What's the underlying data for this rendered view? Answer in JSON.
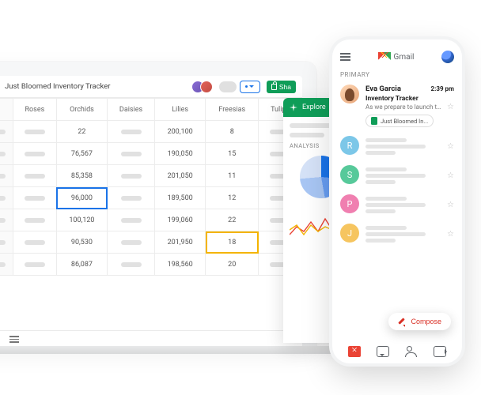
{
  "sheets": {
    "title": "Just Bloomed Inventory Tracker",
    "share_label": "Sha",
    "columns": [
      "Roses",
      "Orchids",
      "Daisies",
      "Lilies",
      "Freesias",
      "Tulips"
    ],
    "rows": [
      {
        "orchids": "22",
        "daisies": null,
        "lilies": "200,100",
        "freesias": "8"
      },
      {
        "orchids": "76,567",
        "daisies": null,
        "lilies": "190,050",
        "freesias": "15"
      },
      {
        "orchids": "85,358",
        "daisies": null,
        "lilies": "201,050",
        "freesias": "11"
      },
      {
        "orchids": "96,000",
        "daisies": null,
        "lilies": "189,500",
        "freesias": "12"
      },
      {
        "orchids": "100,120",
        "daisies": null,
        "lilies": "199,060",
        "freesias": "22"
      },
      {
        "orchids": "90,530",
        "daisies": null,
        "lilies": "201,950",
        "freesias": "18"
      },
      {
        "orchids": "86,087",
        "daisies": null,
        "lilies": "198,560",
        "freesias": "20"
      }
    ],
    "selected_blue": {
      "row": 3,
      "col": "orchids"
    },
    "selected_amber": {
      "row": 5,
      "col": "freesias"
    }
  },
  "explore": {
    "title": "Explore",
    "analysis_label": "ANALYSIS"
  },
  "chart_data": [
    {
      "type": "pie",
      "title": "ANALYSIS",
      "series": [
        {
          "name": "slice1",
          "value": 26,
          "color": "#1a73e8"
        },
        {
          "name": "slice2",
          "value": 21,
          "color": "#679df2"
        },
        {
          "name": "slice3",
          "value": 26,
          "color": "#a8c6f4"
        },
        {
          "name": "slice4",
          "value": 27,
          "color": "#d5e2f7"
        }
      ]
    },
    {
      "type": "line",
      "title": "",
      "x": [
        0,
        1,
        2,
        3,
        4,
        5,
        6,
        7,
        8,
        9
      ],
      "series": [
        {
          "name": "red",
          "color": "#ea4335",
          "values": [
            34,
            24,
            30,
            18,
            30,
            14,
            28,
            12,
            20,
            10
          ]
        },
        {
          "name": "amber",
          "color": "#f4b400",
          "values": [
            28,
            22,
            34,
            22,
            30,
            24,
            28,
            22,
            28,
            26
          ]
        }
      ],
      "xlabel": "",
      "ylabel": "",
      "ylim": [
        0,
        40
      ]
    }
  ],
  "gmail": {
    "brand": "Gmail",
    "primary_label": "PRIMARY",
    "compose_label": "Compose",
    "message": {
      "from": "Eva Garcia",
      "time": "2:39 pm",
      "subject": "Inventory Tracker",
      "preview": "As we prepare to launch the...",
      "chip_label": "Just Bloomed In..."
    },
    "skeleton_avatars": [
      "R",
      "S",
      "P",
      "J"
    ]
  }
}
